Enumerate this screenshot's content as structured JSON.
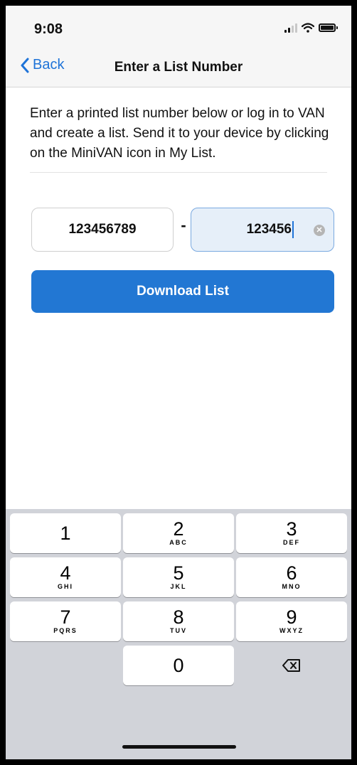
{
  "status_bar": {
    "time": "9:08"
  },
  "nav": {
    "back_label": "Back",
    "title": "Enter a List Number"
  },
  "instructions": "Enter a printed list number below or log in to VAN and create a list.  Send it to your device by clicking on the MiniVAN icon in My List.",
  "list_number": {
    "first_value": "123456789",
    "separator": "-",
    "second_value": "123456"
  },
  "download_label": "Download List",
  "keypad": {
    "keys": [
      {
        "num": "1",
        "letters": ""
      },
      {
        "num": "2",
        "letters": "ABC"
      },
      {
        "num": "3",
        "letters": "DEF"
      },
      {
        "num": "4",
        "letters": "GHI"
      },
      {
        "num": "5",
        "letters": "JKL"
      },
      {
        "num": "6",
        "letters": "MNO"
      },
      {
        "num": "7",
        "letters": "PQRS"
      },
      {
        "num": "8",
        "letters": "TUV"
      },
      {
        "num": "9",
        "letters": "WXYZ"
      },
      {
        "num": "0",
        "letters": ""
      }
    ],
    "delete_icon": "backspace-icon"
  },
  "colors": {
    "accent": "#2277d3",
    "field_active_bg": "#e6eff9",
    "keypad_bg": "#d1d3d9"
  }
}
